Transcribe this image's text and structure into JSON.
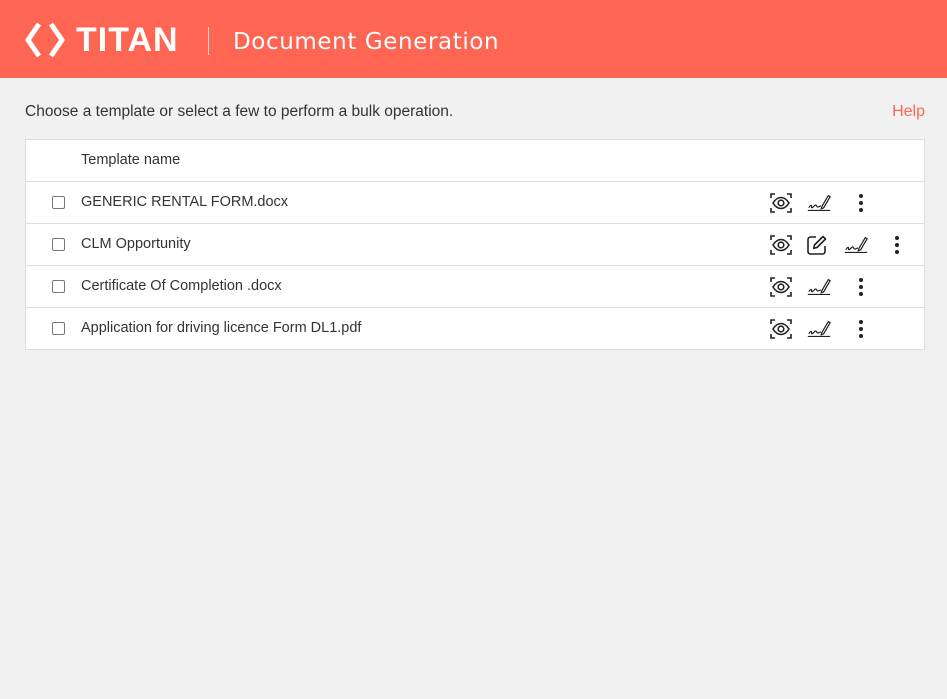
{
  "header": {
    "brand": "TITAN",
    "app_title": "Document Generation",
    "background": "#fe6553"
  },
  "intro_text": "Choose a template or select a few to perform a bulk operation.",
  "help_label": "Help",
  "accent_color": "#fe6553",
  "table": {
    "column_header": "Template name",
    "rows": [
      {
        "name": "GENERIC RENTAL FORM.docx",
        "actions": [
          "preview-icon",
          "sign-icon",
          "more-vertical-icon"
        ]
      },
      {
        "name": "CLM Opportunity",
        "actions": [
          "preview-icon",
          "edit-icon",
          "sign-icon",
          "more-vertical-icon"
        ]
      },
      {
        "name": "Certificate Of Completion .docx",
        "actions": [
          "preview-icon",
          "sign-icon",
          "more-vertical-icon"
        ]
      },
      {
        "name": "Application for driving licence Form DL1.pdf",
        "actions": [
          "preview-icon",
          "sign-icon",
          "more-vertical-icon"
        ]
      }
    ]
  }
}
